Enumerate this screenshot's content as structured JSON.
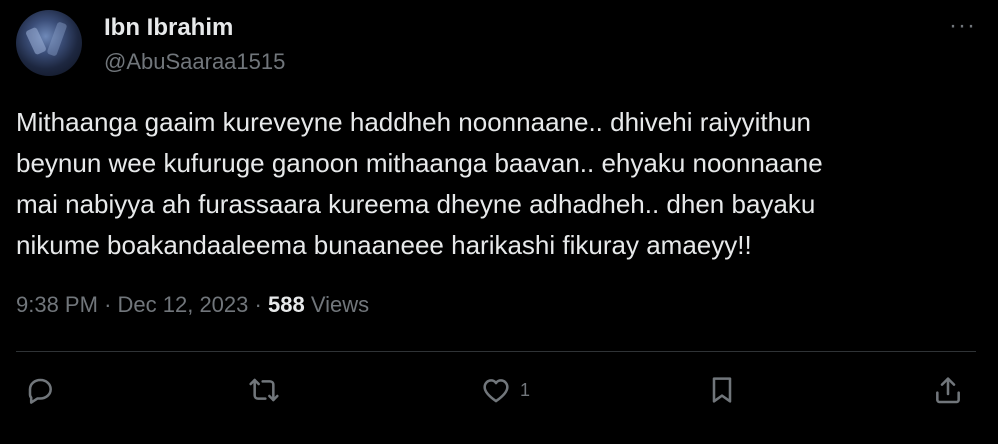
{
  "author": {
    "name": "Ibn Ibrahim",
    "handle": "@AbuSaaraa1515"
  },
  "more_label": "···",
  "tweet": {
    "lines": [
      "Mithaanga gaaim kureveyne haddheh noonnaane.. dhivehi raiyyithun",
      "beynun wee kufuruge ganoon mithaanga baavan.. ehyaku noonnaane",
      "mai nabiyya ah furassaara kureema dheyne adhadheh.. dhen bayaku",
      "nikume boakandaaleema bunaaneee harikashi fikuray amaeyy!!"
    ],
    "time": "9:38 PM",
    "separator1": "·",
    "date": "Dec 12, 2023",
    "separator2": "·",
    "views_count": "588",
    "views_label": "Views"
  },
  "actions": {
    "reply_icon": "reply-icon",
    "retweet_icon": "retweet-icon",
    "like_icon": "heart-icon",
    "like_count": "1",
    "bookmark_icon": "bookmark-icon",
    "share_icon": "share-icon"
  }
}
